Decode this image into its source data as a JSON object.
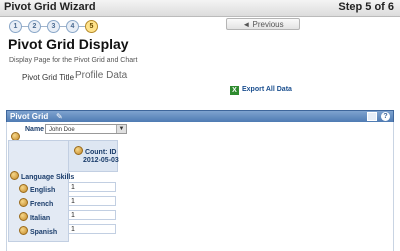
{
  "wizard": {
    "title": "Pivot Grid Wizard",
    "step_text": "Step 5 of 6",
    "steps": [
      "1",
      "2",
      "3",
      "4",
      "5"
    ],
    "active_step": "5",
    "previous_label": "◄ Previous"
  },
  "page": {
    "title": "Pivot Grid Display",
    "subtitle": "Display Page for the Pivot Grid and Chart",
    "pgt_label": "Pivot Grid Title",
    "pgt_value": "Profile Data",
    "export_label": "Export All Data"
  },
  "panel": {
    "title": "Pivot Grid",
    "name_label": "Name",
    "name_value": "John Doe",
    "count_label": "Count: ID",
    "date_label": "2012-05-03",
    "dimension_label": "Language Skills",
    "rows": [
      {
        "label": "English",
        "value": "1"
      },
      {
        "label": "French",
        "value": "1"
      },
      {
        "label": "Italian",
        "value": "1"
      },
      {
        "label": "Spanish",
        "value": "1"
      }
    ]
  }
}
